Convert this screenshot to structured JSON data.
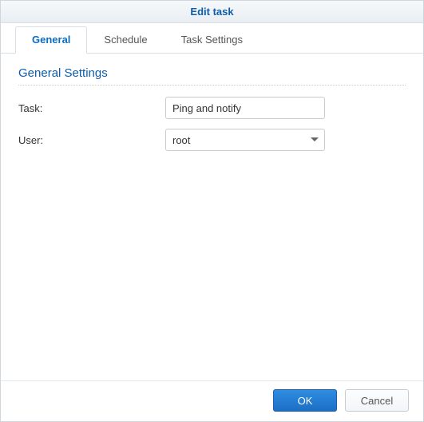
{
  "title": "Edit task",
  "tabs": [
    {
      "label": "General",
      "active": true
    },
    {
      "label": "Schedule",
      "active": false
    },
    {
      "label": "Task Settings",
      "active": false
    }
  ],
  "section_title": "General Settings",
  "form": {
    "task_label": "Task:",
    "task_value": "Ping and notify",
    "user_label": "User:",
    "user_value": "root"
  },
  "buttons": {
    "ok": "OK",
    "cancel": "Cancel"
  }
}
